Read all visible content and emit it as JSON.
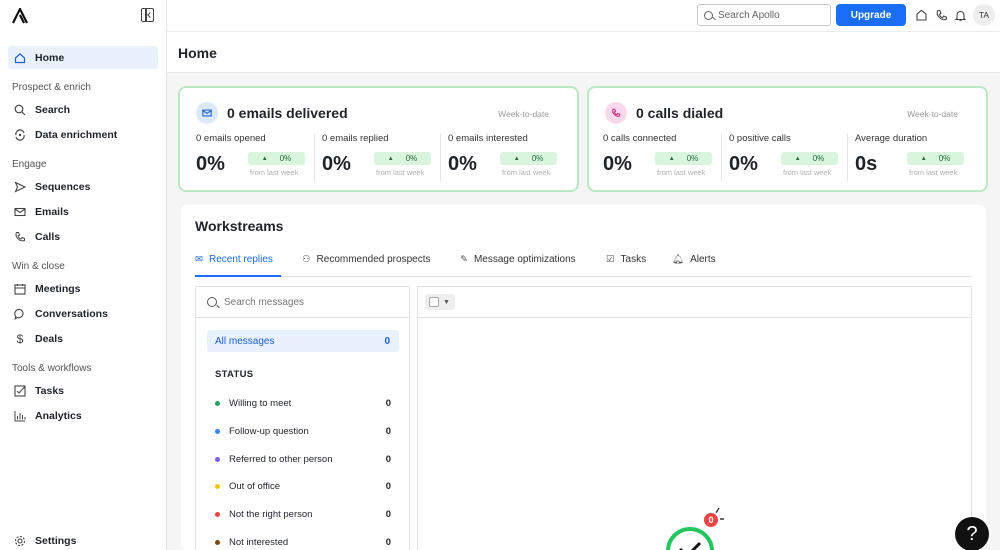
{
  "sidebar": {
    "items": [
      {
        "label": "Home",
        "icon": "home-icon"
      },
      {
        "label": "Search",
        "icon": "search-icon"
      },
      {
        "label": "Data enrichment",
        "icon": "enrich-icon"
      },
      {
        "label": "Sequences",
        "icon": "send-icon"
      },
      {
        "label": "Emails",
        "icon": "mail-icon"
      },
      {
        "label": "Calls",
        "icon": "phone-icon"
      },
      {
        "label": "Meetings",
        "icon": "calendar-icon"
      },
      {
        "label": "Conversations",
        "icon": "chat-icon"
      },
      {
        "label": "Deals",
        "icon": "dollar-icon"
      },
      {
        "label": "Tasks",
        "icon": "checkbox-icon"
      },
      {
        "label": "Analytics",
        "icon": "chart-icon"
      },
      {
        "label": "Settings",
        "icon": "gear-icon"
      }
    ],
    "sections": [
      "Prospect & enrich",
      "Engage",
      "Win & close",
      "Tools & workflows"
    ]
  },
  "header": {
    "search_placeholder": "Search Apollo",
    "upgrade_label": "Upgrade",
    "avatar_initials": "TA"
  },
  "page": {
    "title": "Home"
  },
  "emails_card": {
    "title": "0 emails delivered",
    "period": "Week-to-date",
    "metrics": [
      {
        "label": "0 emails opened",
        "value": "0%",
        "change": "0%",
        "from": "from last week"
      },
      {
        "label": "0 emails replied",
        "value": "0%",
        "change": "0%",
        "from": "from last week"
      },
      {
        "label": "0 emails interested",
        "value": "0%",
        "change": "0%",
        "from": "from last week"
      }
    ]
  },
  "calls_card": {
    "title": "0 calls dialed",
    "period": "Week-to-date",
    "metrics": [
      {
        "label": "0 calls connected",
        "value": "0%",
        "change": "0%",
        "from": "from last week"
      },
      {
        "label": "0 positive calls",
        "value": "0%",
        "change": "0%",
        "from": "from last week"
      },
      {
        "label": "Average duration",
        "value": "0s",
        "change": "0%",
        "from": "from last week"
      }
    ]
  },
  "workstreams": {
    "title": "Workstreams",
    "tabs": [
      {
        "label": "Recent replies",
        "icon": "mail-icon"
      },
      {
        "label": "Recommended prospects",
        "icon": "user-plus-icon"
      },
      {
        "label": "Message optimizations",
        "icon": "pencil-icon"
      },
      {
        "label": "Tasks",
        "icon": "checkbox-icon"
      },
      {
        "label": "Alerts",
        "icon": "bell-icon"
      }
    ],
    "search_placeholder": "Search messages",
    "all_messages": {
      "label": "All messages",
      "count": "0"
    },
    "status_header": "STATUS",
    "statuses": [
      {
        "label": "Willing to meet",
        "count": "0",
        "color": "#22a35a"
      },
      {
        "label": "Follow-up question",
        "count": "0",
        "color": "#3b82f6"
      },
      {
        "label": "Referred to other person",
        "count": "0",
        "color": "#7c5cf0"
      },
      {
        "label": "Out of office",
        "count": "0",
        "color": "#f5c518"
      },
      {
        "label": "Not the right person",
        "count": "0",
        "color": "#ef4444"
      },
      {
        "label": "Not interested",
        "count": "0",
        "color": "#7a4a12"
      }
    ],
    "badge_count": "0"
  },
  "help": {
    "label": "?"
  }
}
